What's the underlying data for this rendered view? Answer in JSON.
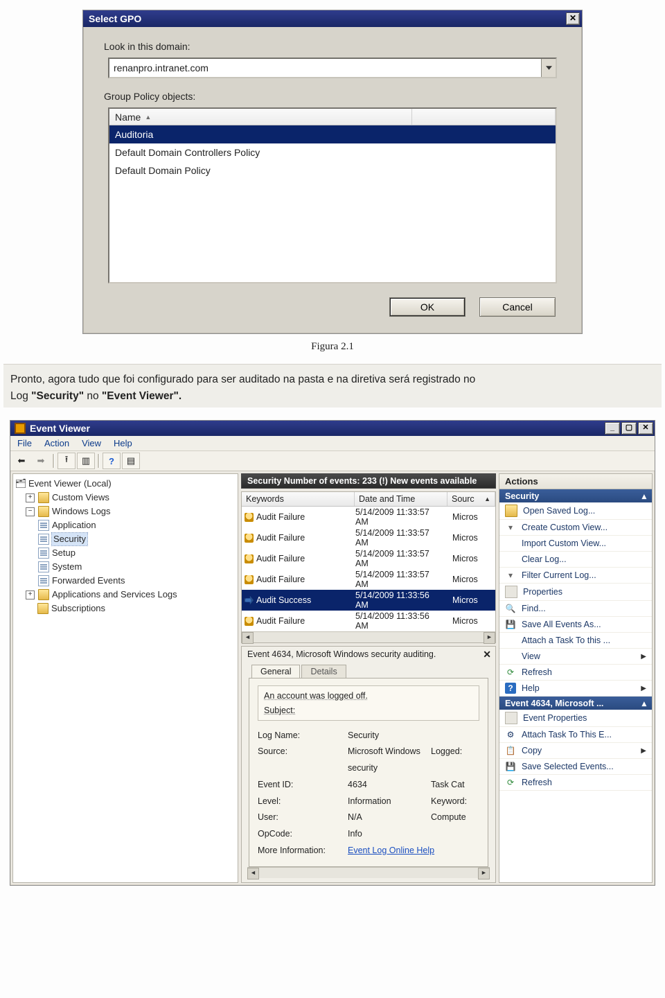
{
  "gpo": {
    "title": "Select GPO",
    "look_label": "Look in this domain:",
    "domain_value": "renanpro.intranet.com",
    "list_label": "Group Policy objects:",
    "column_name": "Name",
    "rows": [
      "Auditoria",
      "Default Domain Controllers Policy",
      "Default Domain Policy"
    ],
    "ok": "OK",
    "cancel": "Cancel",
    "caption": "Figura 2.1"
  },
  "paragraph": {
    "line1_a": "Pronto, agora tudo que foi configurado para ser auditado na pasta e na diretiva será registrado no",
    "line2_a": "Log ",
    "line2_b": "\"Security\"",
    "line2_c": " no",
    "line2_d": "\"Event Viewer\"."
  },
  "ev": {
    "title": "Event Viewer",
    "menu": [
      "File",
      "Action",
      "View",
      "Help"
    ],
    "tree": {
      "root": "Event Viewer (Local)",
      "custom": "Custom Views",
      "winlogs": "Windows Logs",
      "logs": [
        "Application",
        "Security",
        "Setup",
        "System",
        "Forwarded Events"
      ],
      "appsvc": "Applications and Services Logs",
      "subs": "Subscriptions"
    },
    "center_header": "Security   Number of events: 233 (!) New events available",
    "grid": {
      "cols": [
        "Keywords",
        "Date and Time",
        "Sourc"
      ],
      "rows": [
        {
          "kw": "Audit Failure",
          "dt": "5/14/2009 11:33:57 AM",
          "src": "Micros",
          "icon": "lock"
        },
        {
          "kw": "Audit Failure",
          "dt": "5/14/2009 11:33:57 AM",
          "src": "Micros",
          "icon": "lock"
        },
        {
          "kw": "Audit Failure",
          "dt": "5/14/2009 11:33:57 AM",
          "src": "Micros",
          "icon": "lock"
        },
        {
          "kw": "Audit Failure",
          "dt": "5/14/2009 11:33:57 AM",
          "src": "Micros",
          "icon": "lock"
        },
        {
          "kw": "Audit Success",
          "dt": "5/14/2009 11:33:56 AM",
          "src": "Micros",
          "icon": "key",
          "selected": true
        },
        {
          "kw": "Audit Failure",
          "dt": "5/14/2009 11:33:56 AM",
          "src": "Micros",
          "icon": "lock"
        }
      ]
    },
    "detail": {
      "title": "Event 4634, Microsoft Windows security auditing.",
      "tab_general": "General",
      "tab_details": "Details",
      "msg1": "An account was logged off.",
      "msg2": "Subject:",
      "fields": {
        "logname_k": "Log Name:",
        "logname_v": "Security",
        "source_k": "Source:",
        "source_v": "Microsoft Windows security",
        "logged_k": "Logged:",
        "eventid_k": "Event ID:",
        "eventid_v": "4634",
        "taskcat_k": "Task Cat",
        "level_k": "Level:",
        "level_v": "Information",
        "keywords_k": "Keyword:",
        "user_k": "User:",
        "user_v": "N/A",
        "computer_k": "Compute",
        "opcode_k": "OpCode:",
        "opcode_v": "Info",
        "more_k": "More Information:",
        "more_link": "Event Log Online Help"
      }
    },
    "actions": {
      "title": "Actions",
      "section1": "Security",
      "items1": [
        "Open Saved Log...",
        "Create Custom View...",
        "Import Custom View...",
        "Clear Log...",
        "Filter Current Log...",
        "Properties",
        "Find...",
        "Save All Events As...",
        "Attach a Task To this ...",
        "View",
        "Refresh",
        "Help"
      ],
      "section2": "Event 4634, Microsoft ...",
      "items2": [
        "Event Properties",
        "Attach Task To This E...",
        "Copy",
        "Save Selected Events...",
        "Refresh"
      ]
    }
  }
}
